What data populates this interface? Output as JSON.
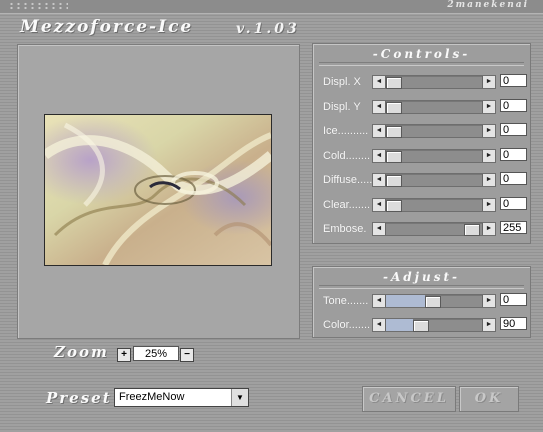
{
  "header": {
    "brand": "2manekenai",
    "title": "Mezzoforce-Ice",
    "version": "v.1.03"
  },
  "controls": {
    "title": "-Controls-",
    "sliders": [
      {
        "label": "Displ. X",
        "value": "0",
        "level": 0
      },
      {
        "label": "Displ. Y",
        "value": "0",
        "level": 0
      },
      {
        "label": "Ice..........",
        "value": "0",
        "level": 0
      },
      {
        "label": "Cold........",
        "value": "0",
        "level": 0
      },
      {
        "label": "Diffuse.....",
        "value": "0",
        "level": 0
      },
      {
        "label": "Clear.......",
        "value": "0",
        "level": 0
      },
      {
        "label": "Embose.",
        "value": "255",
        "level": 1
      }
    ]
  },
  "adjust": {
    "title": "-Adjust-",
    "sliders": [
      {
        "label": "Tone.......",
        "value": "0",
        "level": 0.5
      },
      {
        "label": "Color.......",
        "value": "90",
        "level": 0.35
      }
    ]
  },
  "zoom": {
    "label": "Zoom",
    "value": "25%",
    "plus": "+",
    "minus": "−"
  },
  "preset": {
    "label": "Preset",
    "selected": "FreezMeNow"
  },
  "buttons": {
    "cancel": "CANCEL",
    "ok": "OK"
  },
  "colors": {
    "slider_fill": "#aebbd3",
    "panel": "#9d9d9d"
  }
}
